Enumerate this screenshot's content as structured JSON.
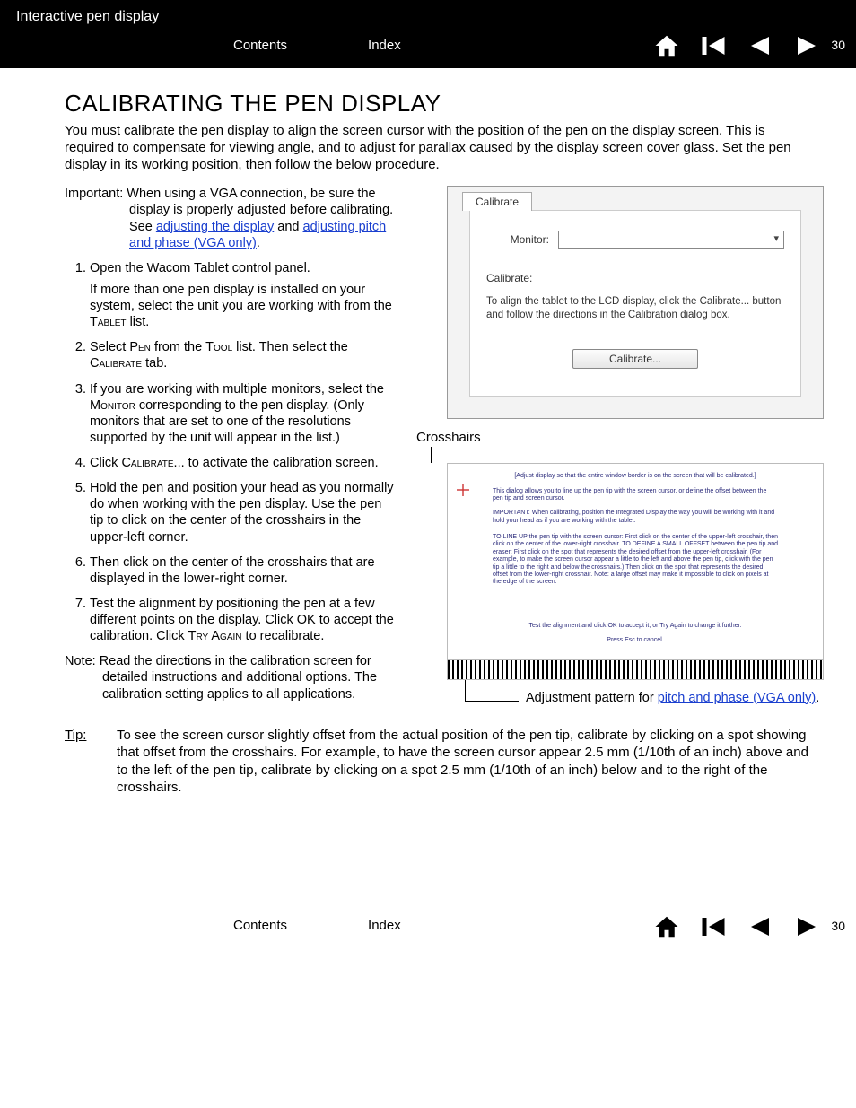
{
  "header": {
    "product": "Interactive pen display",
    "contents": "Contents",
    "index": "Index",
    "page_number": "30"
  },
  "title": "CALIBRATING THE PEN DISPLAY",
  "intro": "You must calibrate the pen display to align the screen cursor with the position of the pen on the display screen.  This is required to compensate for viewing angle, and to adjust for parallax caused by the display screen cover glass.  Set the pen display in its working position, then follow the below procedure.",
  "important": {
    "label": "Important:",
    "body_pre": " When using a VGA connection, be sure the display is properly adjusted before calibrating.  See ",
    "link1": "adjusting the display",
    "mid": " and ",
    "link2": "adjusting pitch and phase (VGA only)",
    "end": "."
  },
  "steps": {
    "s1a": "Open the Wacom Tablet control panel.",
    "s1b_pre": "If more than one pen display is installed on your system, select the unit you are working with from the ",
    "s1b_sc": "Tablet",
    "s1b_post": " list.",
    "s2_pre": "Select ",
    "s2_sc1": "Pen",
    "s2_mid": " from the ",
    "s2_sc2": "Tool",
    "s2_post1": " list. Then select the ",
    "s2_sc3": "Calibrate",
    "s2_post2": " tab.",
    "s3_pre": "If you are working with multiple monitors, select the ",
    "s3_sc": "Monitor",
    "s3_post": " corresponding to the pen display.  (Only monitors that are set to one of the resolutions supported by the unit will appear in the list.)",
    "s4_pre": "Click ",
    "s4_sc": "Calibrate",
    "s4_post": "... to activate the calibration screen.",
    "s5": "Hold the pen and position your head as you normally do when working with the pen display.  Use the pen tip to click on the center of the crosshairs in the upper-left corner.",
    "s6": "Then click on the center of the crosshairs that are displayed in the lower-right corner.",
    "s7_pre": "Test the alignment by positioning the pen at a few different points on the display.  Click OK to accept the calibration.  Click ",
    "s7_sc": "Try Again",
    "s7_post": " to recalibrate."
  },
  "note": {
    "label": "Note:",
    "body": "  Read the directions in the calibration screen for detailed instructions and additional options.  The calibration setting applies to all applications."
  },
  "panel": {
    "tab": "Calibrate",
    "monitor_label": "Monitor:",
    "calibrate_label": "Calibrate:",
    "instructions": "To align the tablet to the LCD display, click the Calibrate... button and follow the directions in the Calibration dialog box.",
    "button": "Calibrate..."
  },
  "crosshairs": {
    "label": "Crosshairs",
    "l1": "[Adjust display so that the entire window border is on the screen that will be calibrated.]",
    "l2": "This dialog allows you to line up the pen tip with the screen cursor, or define the offset between the pen tip and screen cursor.",
    "l3": "IMPORTANT: When calibrating, position the Integrated Display the way you will be working with it and hold your head as if you are working with the tablet.",
    "l4": "TO LINE UP the pen tip with the screen cursor: First click on the center of the upper-left crosshair, then click on the center of the lower-right crosshair. TO DEFINE A SMALL OFFSET between the pen tip and eraser: First click on the spot that represents the desired offset from the upper-left crosshair. (For example, to make the screen cursor appear a little to the left and above the pen tip, click with the pen tip a little to the right and below the crosshairs.) Then click on the spot that represents the desired offset from the lower-right crosshair. Note: a large offset may make it impossible to click on pixels at the edge of the screen.",
    "l5": "Test the alignment and click OK to accept it, or Try Again to change it further.",
    "l6": "Press Esc to cancel."
  },
  "adjustment": {
    "pre": "Adjustment pattern for ",
    "link": "pitch and phase (VGA only)",
    "post": "."
  },
  "tip": {
    "label": "Tip",
    "colon": ":",
    "body": "To see the screen cursor slightly offset from the actual position of the pen tip, calibrate by clicking on a spot showing that offset from the crosshairs.  For example, to have the screen cursor appear 2.5 mm (1/10th of an inch) above and to the left of the pen tip, calibrate by clicking on a spot 2.5 mm (1/10th of an inch) below and to the right of the crosshairs."
  },
  "footer": {
    "contents": "Contents",
    "index": "Index",
    "page_number": "30"
  }
}
